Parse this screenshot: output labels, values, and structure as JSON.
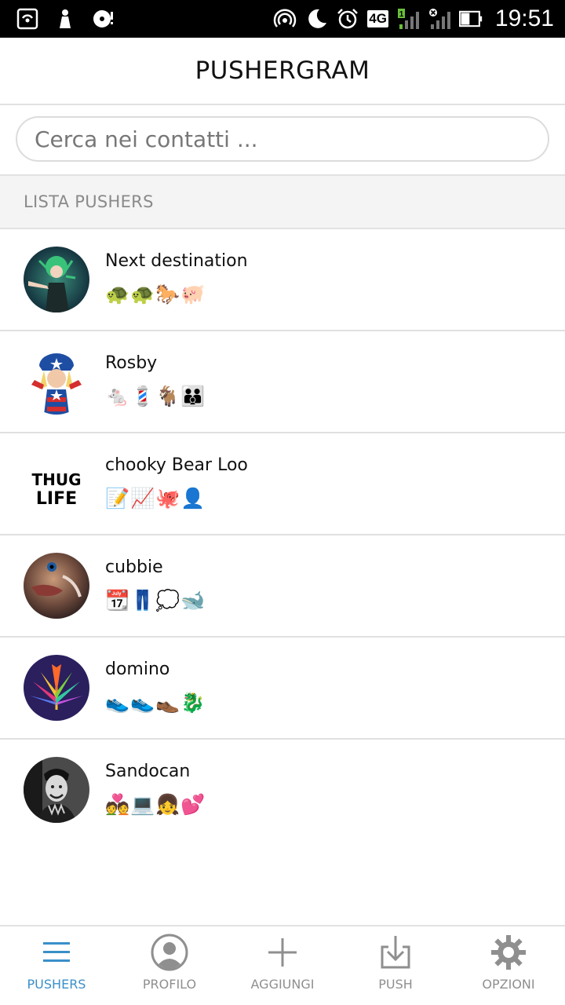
{
  "status_bar": {
    "time": "19:51",
    "network_badge": "4G",
    "signal_sim1_label": "1",
    "left_icons": [
      "hotspot-icon",
      "notification-icon",
      "sync-icon"
    ],
    "right_icons": [
      "wifi-hotspot-icon",
      "moon-icon",
      "alarm-icon",
      "4g-icon",
      "signal-icon",
      "signal-off-icon",
      "battery-icon"
    ]
  },
  "header": {
    "title": "PUSHERGRAM"
  },
  "search": {
    "placeholder": "Cerca nei contatti ..."
  },
  "section": {
    "title": "LISTA PUSHERS"
  },
  "contacts": [
    {
      "name": "Next destination",
      "emojis": "🐢🐢🐎🐖"
    },
    {
      "name": "Rosby",
      "emojis": "🐁💈🐐👪"
    },
    {
      "name": "chooky Bear Loo",
      "emojis": "📝📈🐙👤"
    },
    {
      "name": "cubbie",
      "emojis": "📆👖💭🐋"
    },
    {
      "name": "domino",
      "emojis": "👟👟👞🐉"
    },
    {
      "name": "Sandocan",
      "emojis": "💑💻👧💕"
    }
  ],
  "avatar_3_text": {
    "line1": "THUG",
    "line2": "LIFE"
  },
  "bottom_nav": [
    {
      "label": "PUSHERS",
      "icon": "menu-icon",
      "active": true
    },
    {
      "label": "PROFILO",
      "icon": "profile-icon",
      "active": false
    },
    {
      "label": "AGGIUNGI",
      "icon": "add-icon",
      "active": false
    },
    {
      "label": "PUSH",
      "icon": "download-icon",
      "active": false
    },
    {
      "label": "OPZIONI",
      "icon": "gear-icon",
      "active": false
    }
  ],
  "colors": {
    "accent": "#3a8fc9",
    "inactive": "#8f8f8f",
    "divider": "#e2e2e2",
    "section_bg": "#f4f4f4"
  }
}
